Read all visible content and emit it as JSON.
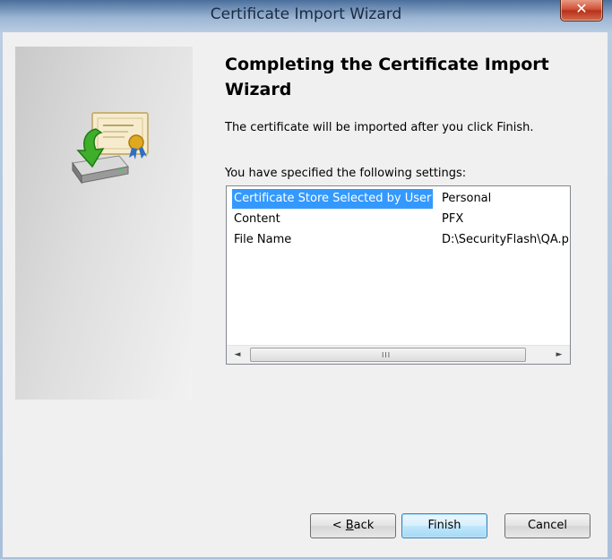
{
  "window": {
    "title": "Certificate Import Wizard",
    "close_glyph": "✕"
  },
  "wizard": {
    "heading": "Completing the Certificate Import Wizard",
    "intro": "The certificate will be imported after you click Finish.",
    "settings_label": "You have specified the following settings:"
  },
  "settings_list": {
    "rows": [
      {
        "key": "Certificate Store Selected by User",
        "value": "Personal",
        "selected": true
      },
      {
        "key": "Content",
        "value": "PFX",
        "selected": false
      },
      {
        "key": "File Name",
        "value": "D:\\SecurityFlash\\QA.p",
        "selected": false
      }
    ],
    "scroll_grip": "III"
  },
  "buttons": {
    "back_prefix": "< ",
    "back_accel": "B",
    "back_rest": "ack",
    "finish": "Finish",
    "cancel": "Cancel"
  },
  "icons": {
    "certificate": "certificate-import-icon",
    "scroll_left": "◄",
    "scroll_right": "►"
  },
  "colors": {
    "selection": "#3399ff",
    "default_button_border": "#3c7fb1"
  }
}
